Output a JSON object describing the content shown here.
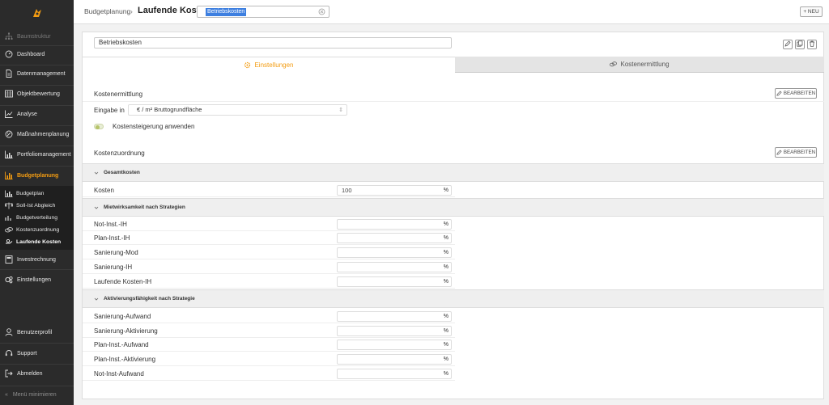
{
  "sidebar": {
    "items": [
      {
        "label": "Baumstruktur",
        "icon": "tree-icon",
        "state": "disabled"
      },
      {
        "label": "Dashboard",
        "icon": "dashboard-icon"
      },
      {
        "label": "Datenmanagement",
        "icon": "document-icon"
      },
      {
        "label": "Objektbewertung",
        "icon": "grid-icon"
      },
      {
        "label": "Analyse",
        "icon": "chart-line-icon"
      },
      {
        "label": "Maßnahmenplanung",
        "icon": "tools-icon"
      },
      {
        "label": "Portfoliomanagement",
        "icon": "portfolio-icon"
      },
      {
        "label": "Budgetplanung",
        "icon": "bar-chart-icon",
        "state": "active"
      }
    ],
    "sub_items": [
      {
        "label": "Budgetplan",
        "icon": "bar-chart-icon"
      },
      {
        "label": "Soll-Ist Abgleich",
        "icon": "scale-icon"
      },
      {
        "label": "Budgetverteilung",
        "icon": "distribution-icon"
      },
      {
        "label": "Kostenzuordnung",
        "icon": "coins-icon"
      },
      {
        "label": "Laufende Kosten",
        "icon": "money-icon",
        "state": "current"
      }
    ],
    "after_items": [
      {
        "label": "Investrechnung",
        "icon": "calculator-icon"
      },
      {
        "label": "Einstellungen",
        "icon": "gears-icon"
      }
    ],
    "bottom_items": [
      {
        "label": "Benutzerprofil",
        "icon": "user-icon"
      },
      {
        "label": "Support",
        "icon": "support-icon"
      },
      {
        "label": "Abmelden",
        "icon": "logout-icon"
      }
    ],
    "collapse_label": "Menü minimieren"
  },
  "header": {
    "breadcrumb": "Budgetplanung",
    "separator": "›",
    "title": "Laufende Kosten",
    "selected_value": "Betriebskosten",
    "new_button": "+ NEU"
  },
  "main": {
    "name_value": "Betriebskosten",
    "tabs": [
      {
        "label": "Einstellungen",
        "icon": "gear-icon",
        "active": true
      },
      {
        "label": "Kostenermittlung",
        "icon": "coins-icon",
        "active": false
      }
    ],
    "kostenermittlung": {
      "title": "Kostenermittlung",
      "edit_label": "BEARBEITEN",
      "eingabe_label": "Eingabe in",
      "eingabe_value": "€ / m² Bruttogrundfläche",
      "toggle_label": "Kostensteigerung anwenden",
      "toggle_on": true
    },
    "kostenzuordnung": {
      "title": "Kostenzuordnung",
      "edit_label": "BEARBEITEN"
    },
    "groups": [
      {
        "title": "Gesamtkosten",
        "rows": [
          {
            "label": "Kosten",
            "value": "100",
            "unit": "%"
          }
        ]
      },
      {
        "title": "Mietwirksamkeit nach Strategien",
        "rows": [
          {
            "label": "Not-Inst.-IH",
            "value": "",
            "unit": "%"
          },
          {
            "label": "Plan-Inst.-IH",
            "value": "",
            "unit": "%"
          },
          {
            "label": "Sanierung-Mod",
            "value": "",
            "unit": "%"
          },
          {
            "label": "Sanierung-IH",
            "value": "",
            "unit": "%"
          },
          {
            "label": "Laufende Kosten-IH",
            "value": "",
            "unit": "%"
          }
        ]
      },
      {
        "title": "Aktivierungsfähigkeit nach Strategie",
        "rows": [
          {
            "label": "Sanierung-Aufwand",
            "value": "",
            "unit": "%"
          },
          {
            "label": "Sanierung-Aktivierung",
            "value": "",
            "unit": "%"
          },
          {
            "label": "Plan-Inst.-Aufwand",
            "value": "",
            "unit": "%"
          },
          {
            "label": "Plan-Inst.-Aktivierung",
            "value": "",
            "unit": "%"
          },
          {
            "label": "Not-Inst-Aufwand",
            "value": "",
            "unit": "%"
          }
        ]
      }
    ]
  },
  "colors": {
    "accent": "#f39c12",
    "sidebar_bg": "#2b2b2b",
    "selection": "#3d7fe0"
  }
}
